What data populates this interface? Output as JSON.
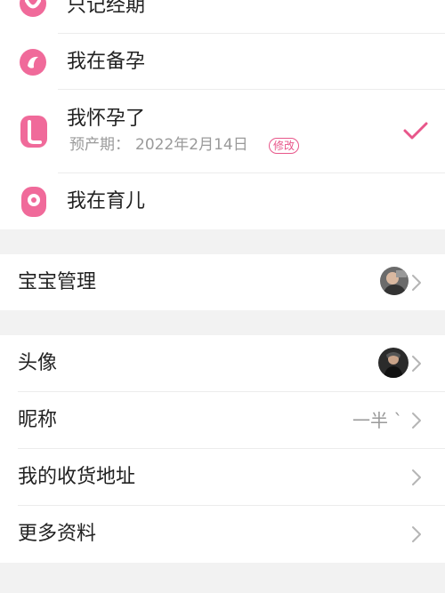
{
  "status_mode": {
    "items": [
      {
        "label": "只记经期",
        "icon": "period-icon"
      },
      {
        "label": "我在备孕",
        "icon": "trying-to-conceive-icon"
      },
      {
        "label": "我怀孕了",
        "icon": "pregnant-icon",
        "sub_prefix": "预产期：",
        "due_date": "2022年2月14日",
        "edit_label": "修改",
        "selected": true
      },
      {
        "label": "我在育儿",
        "icon": "parenting-icon"
      }
    ],
    "accent_color": "#e8568a",
    "check_icon": "checkmark-icon"
  },
  "baby": {
    "label": "宝宝管理",
    "avatar_icon": "baby-avatar"
  },
  "profile": {
    "items": [
      {
        "label": "头像",
        "value_icon": "user-avatar"
      },
      {
        "label": "昵称",
        "value": "一半 `"
      },
      {
        "label": "我的收货地址"
      },
      {
        "label": "更多资料"
      }
    ],
    "chevron_icon": "chevron-right-icon"
  }
}
